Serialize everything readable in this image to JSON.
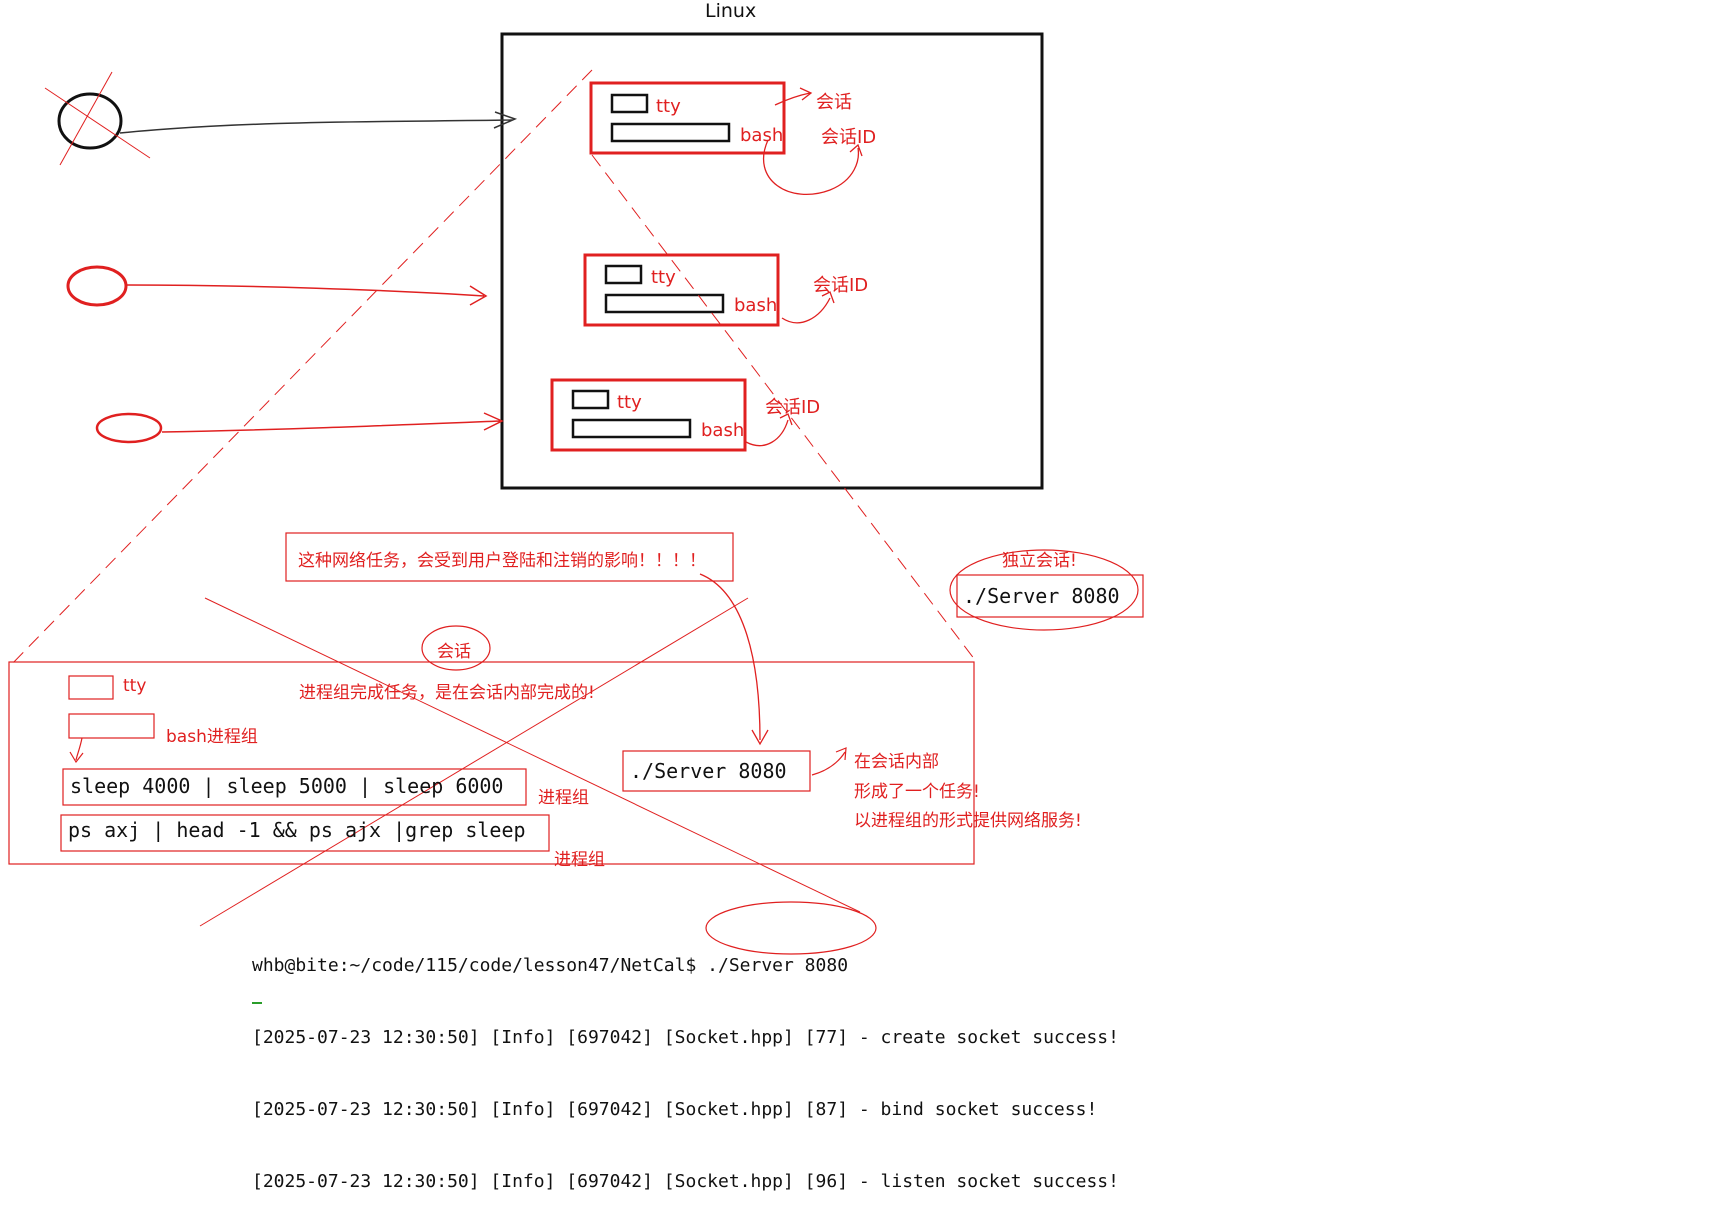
{
  "diagram": {
    "title": "Linux",
    "sessions": [
      {
        "tty": "tty",
        "bash": "bash",
        "annotation_top": "会话",
        "annotation": "会话ID"
      },
      {
        "tty": "tty",
        "bash": "bash",
        "annotation": "会话ID"
      },
      {
        "tty": "tty",
        "bash": "bash",
        "annotation": "会话ID"
      }
    ],
    "network_task_warning": "这种网络任务，会受到用户登陆和注销的影响！！！！",
    "independent_session": {
      "label": "独立会话!",
      "command": "./Server 8080"
    },
    "zoom_panel": {
      "session_circle": "会话",
      "explanation": "进程组完成任务，是在会话内部完成的!",
      "tty": "tty",
      "bash_group": "bash进程组",
      "pipeline1": "sleep 4000 | sleep 5000 | sleep 6000",
      "pipeline1_label": "进程组",
      "pipeline2": "ps axj | head -1 && ps ajx |grep sleep",
      "pipeline2_label": "进程组",
      "server_command": "./Server 8080",
      "server_notes": [
        "在会话内部",
        "形成了一个任务!",
        "以进程组的形式提供网络服务!"
      ]
    },
    "terminal": [
      "whb@bite:~/code/115/code/lesson47/NetCal$ ./Server 8080",
      "[2025-07-23 12:30:50] [Info] [697042] [Socket.hpp] [77] - create socket success!",
      "[2025-07-23 12:30:50] [Info] [697042] [Socket.hpp] [87] - bind socket success!",
      "[2025-07-23 12:30:50] [Info] [697042] [Socket.hpp] [96] - listen socket success!"
    ]
  },
  "colors": {
    "ink_black": "#111111",
    "ink_red": "#e02020"
  }
}
